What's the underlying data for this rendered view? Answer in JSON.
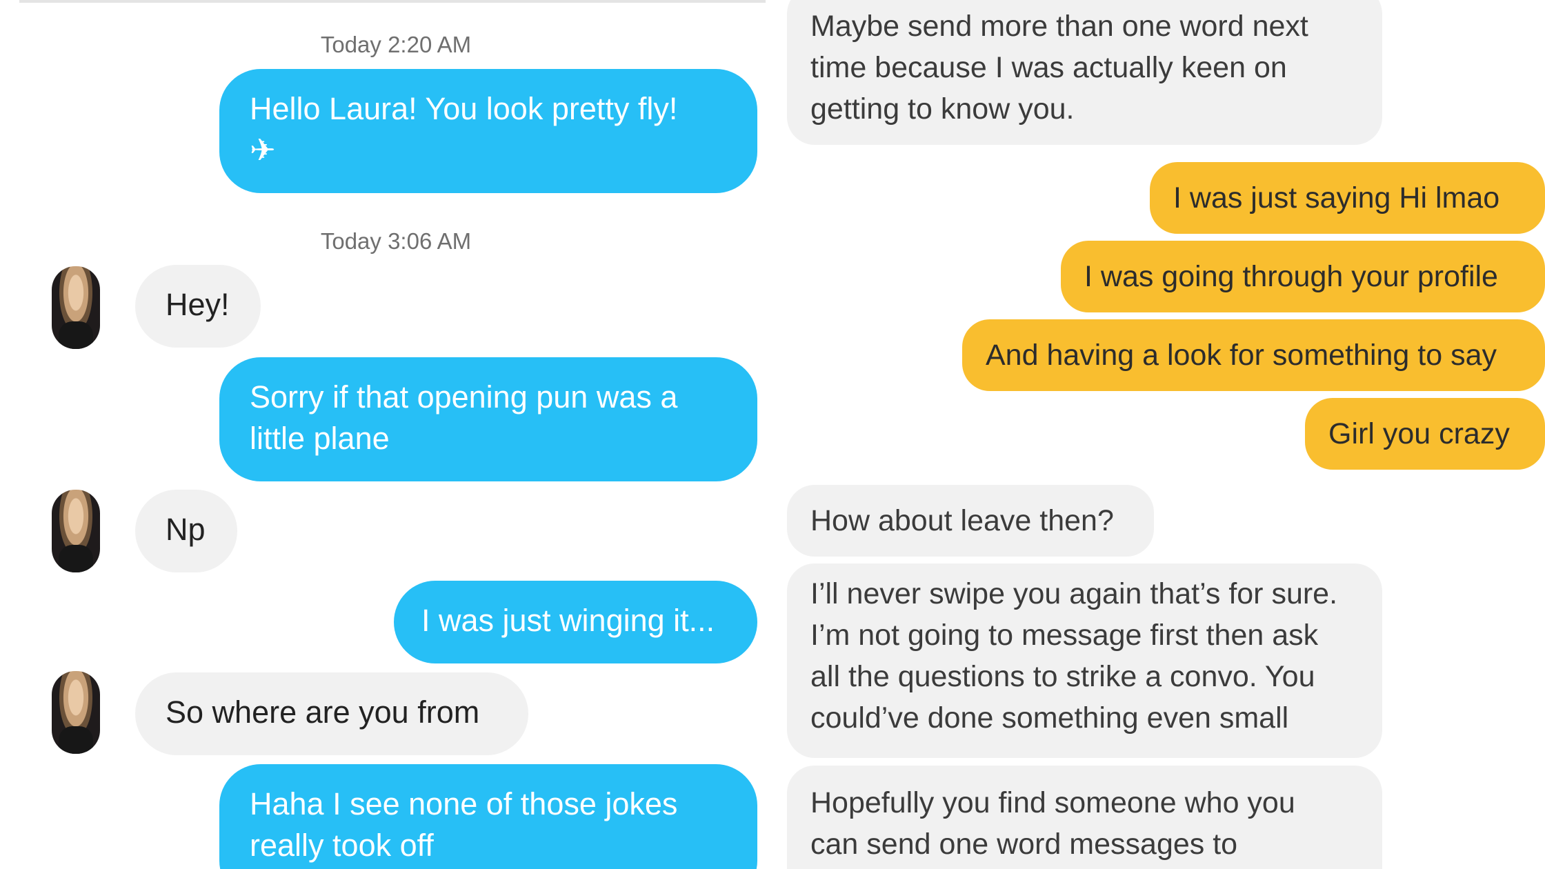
{
  "left_panel": {
    "timestamps": [
      "Today 2:20 AM",
      "Today 3:06 AM"
    ],
    "messages": {
      "m1": [
        "Hello Laura!  You look pretty fly!",
        "✈"
      ],
      "m2": "Hey!",
      "m3": [
        "Sorry if that opening pun was a",
        "little plane"
      ],
      "m4": "Np",
      "m5": "I was just winging it...",
      "m6": "So where are you from",
      "m7": [
        "Haha I see none of those jokes",
        "really took off"
      ]
    }
  },
  "right_panel": {
    "messages": {
      "r1": [
        "Maybe send more than one word next",
        "time because I was actually keen on",
        "getting to know you."
      ],
      "r2": "I was just saying Hi lmao",
      "r3": "I was going through your profile",
      "r4": "And having a look for something to say",
      "r5": "Girl you crazy",
      "r6": "How about leave then?",
      "r7": [
        "I’ll never swipe you again that’s for sure.",
        "I’m not going to message first then ask",
        "all the questions to strike a convo. You",
        "could’ve done something even small"
      ],
      "r8": [
        "Hopefully you find someone who you",
        "can send one word messages to"
      ]
    }
  },
  "colors": {
    "sent_blue": "#27bff6",
    "sent_yellow": "#f9be2f",
    "received_gray": "#f1f1f1"
  }
}
